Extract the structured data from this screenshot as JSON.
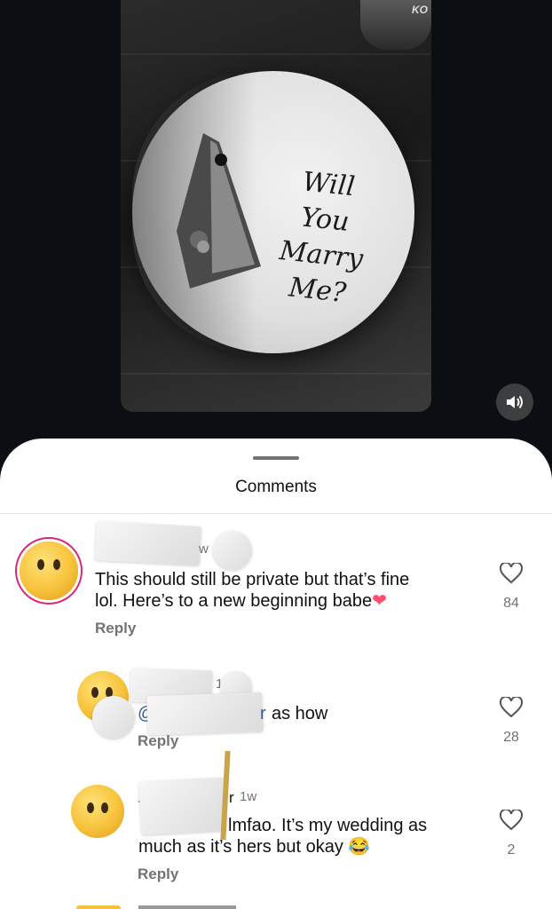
{
  "media": {
    "inscription_lines": [
      "Will",
      "You Marry",
      "Me?"
    ],
    "cup_brand": "KO",
    "sound_icon": "speaker-on-icon"
  },
  "comments_sheet": {
    "title": "Comments",
    "comments": [
      {
        "time": "w",
        "text_line1": "This should still be private but that’s fine",
        "text_line2": "lol. Here’s to a new beginning babe",
        "emoji": "❤",
        "reply_label": "Reply",
        "like_count": "84"
      },
      {
        "time": "1",
        "mention_prefix": "@",
        "mention_suffix": "r",
        "text": "as how",
        "reply_label": "Reply",
        "like_count": "28"
      },
      {
        "username_suffix": "r",
        "time": "1w",
        "prefix": "-",
        "text_line1": "lmfao. It’s my wedding as",
        "text_line2": "much as it’s hers but okay",
        "emoji": "😂",
        "reply_label": "Reply",
        "like_count": "2"
      }
    ]
  },
  "colors": {
    "background": "#0b0f14",
    "sheet": "#ffffff",
    "muted_text": "#737373",
    "story_ring": "#d62976"
  }
}
